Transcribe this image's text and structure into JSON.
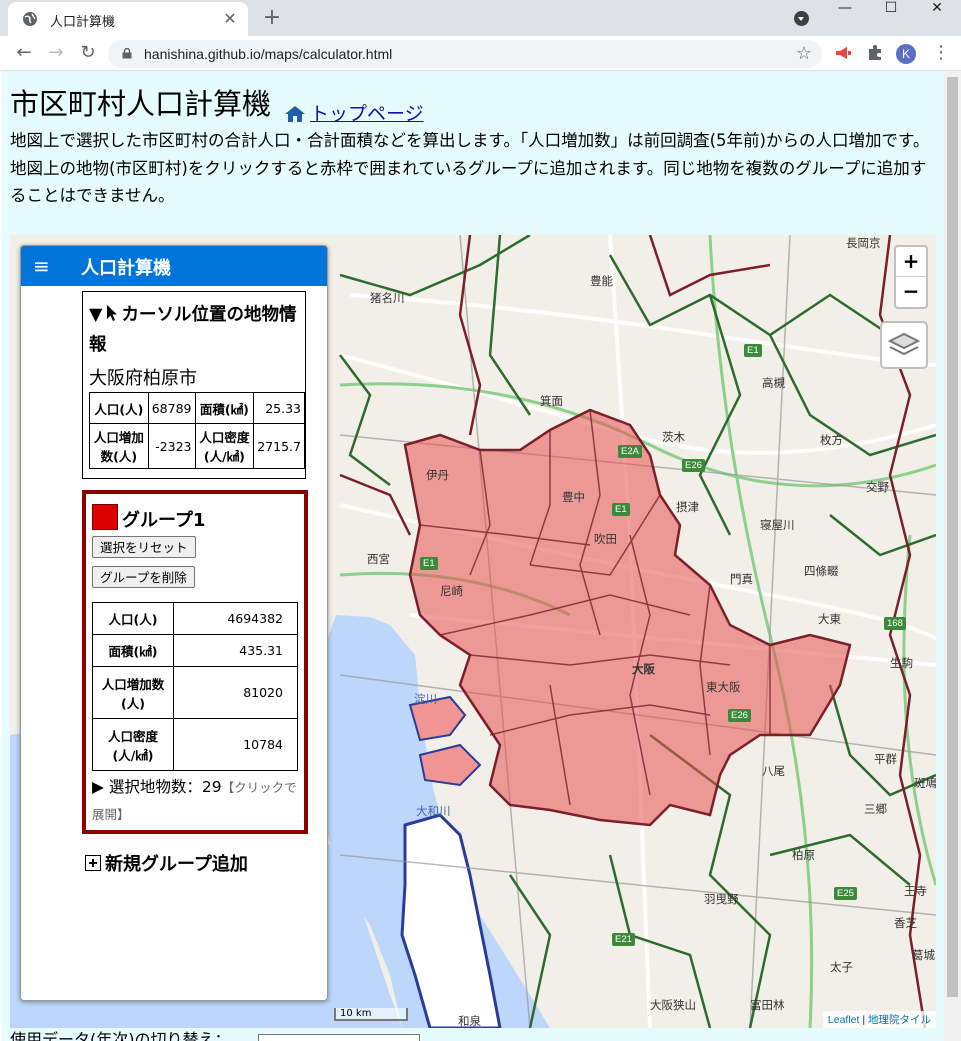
{
  "browser": {
    "tab_title": "人口計算機",
    "tab_close": "✕",
    "new_tab": "+",
    "url": "hanishina.github.io/maps/calculator.html",
    "profile_initial": "K",
    "window_min": "—",
    "window_max": "☐",
    "window_close": "✕"
  },
  "page": {
    "title": "市区町村人口計算機",
    "home_link": "トップページ",
    "desc1": "地図上で選択した市区町村の合計人口・合計面積などを算出します。「人口増加数」は前回調査(5年前)からの人口増加です。",
    "desc2": "地図上の地物(市区町村)をクリックすると赤枠で囲まれているグループに追加されます。同じ地物を複数のグループに追加することはできません。",
    "footer": "使用データ(年次)の切り替え："
  },
  "panel": {
    "title": "人口計算機",
    "menu_icon": "≡",
    "cursor_info_heading": "カーソル位置の地物情報",
    "toggle_open": "▼",
    "place": "大阪府柏原市",
    "info": {
      "pop_label": "人口(人)",
      "pop_value": "68789",
      "area_label": "面積(㎢)",
      "area_value": "25.33",
      "inc_label": "人口増加数(人)",
      "inc_value": "-2323",
      "dens_label": "人口密度(人/㎢)",
      "dens_value": "2715.7"
    },
    "group": {
      "name": "グループ1",
      "color": "#dd0000",
      "reset_button": "選択をリセット",
      "delete_button": "グループを削除",
      "pop_label": "人口(人)",
      "pop_value": "4694382",
      "area_label": "面積(㎢)",
      "area_value": "435.31",
      "inc_label": "人口増加数(人)",
      "inc_value": "81020",
      "dens_label": "人口密度(人/㎢)",
      "dens_value": "10784",
      "toggle_closed": "▶",
      "selected_count": "選択地物数：29",
      "hint": "【クリックで展開】"
    },
    "add_group": "新規グループ追加"
  },
  "map": {
    "zoom_in": "+",
    "zoom_out": "−",
    "scale": "10 km",
    "attrib_leaflet": "Leaflet",
    "attrib_sep": " | ",
    "attrib_gsi": "地理院タイル",
    "labels": [
      "豊能",
      "長岡京",
      "猪名川",
      "箕面",
      "高槻",
      "枚方",
      "茨木",
      "伊丹",
      "豊中",
      "吹田",
      "摂津",
      "寝屋川",
      "交野",
      "西宮",
      "尼崎",
      "門真",
      "四條畷",
      "大阪",
      "大東",
      "東大阪",
      "生駒",
      "八尾",
      "平群",
      "斑鳩",
      "柏原",
      "三郷",
      "大和川",
      "羽曳野",
      "香芝",
      "王寺",
      "太子",
      "大阪狭山",
      "富田林",
      "葛城",
      "和泉",
      "淀川"
    ],
    "roads": [
      "E1",
      "E2A",
      "E26",
      "E1",
      "E1",
      "E26",
      "E25",
      "E21",
      "168"
    ]
  }
}
